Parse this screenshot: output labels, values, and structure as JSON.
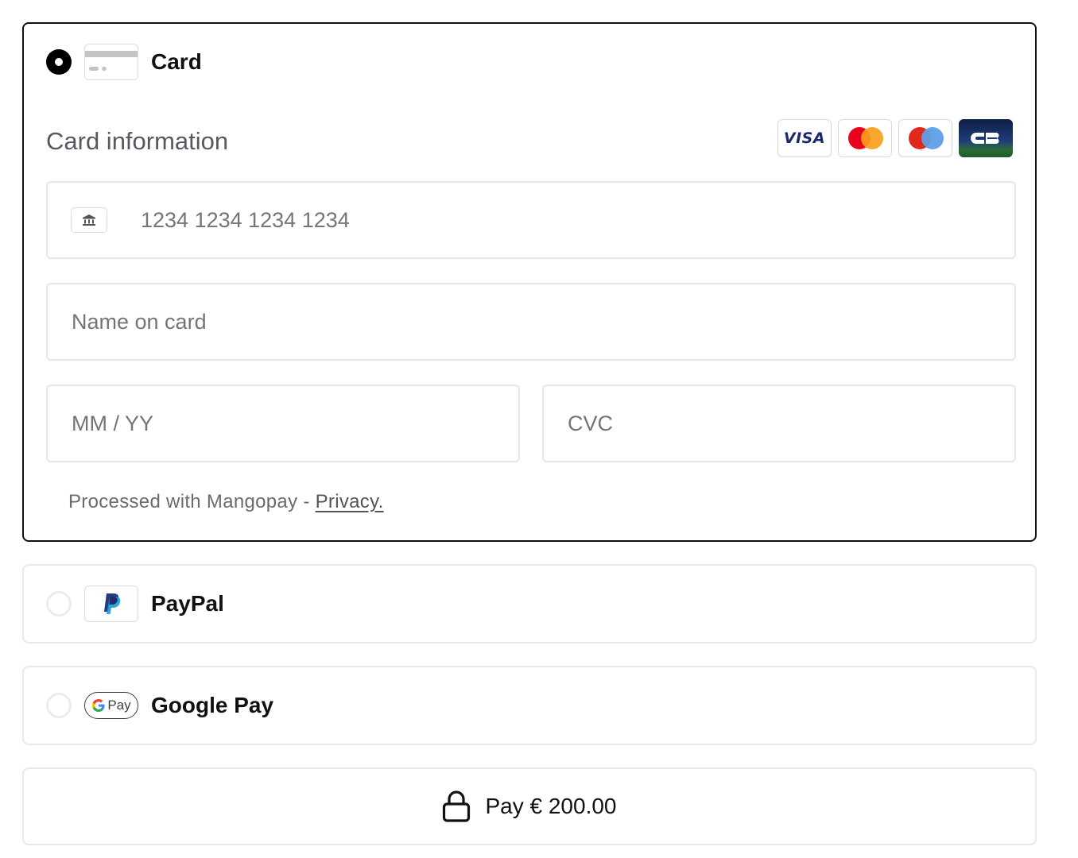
{
  "methods": {
    "card": {
      "label": "Card",
      "selected": true,
      "icon": "credit-card-icon",
      "card_information_title": "Card information",
      "brands": [
        {
          "name": "visa",
          "text": "VISA"
        },
        {
          "name": "mastercard"
        },
        {
          "name": "maestro"
        },
        {
          "name": "cb"
        }
      ],
      "fields": {
        "card_number": {
          "placeholder": "1234 1234 1234 1234",
          "icon": "bank-icon"
        },
        "name_on_card": {
          "placeholder": "Name on card"
        },
        "expiry": {
          "placeholder": "MM / YY"
        },
        "cvc": {
          "placeholder": "CVC"
        }
      },
      "processed_text": "Processed with Mangopay - ",
      "privacy_link": "Privacy."
    },
    "paypal": {
      "label": "PayPal",
      "selected": false,
      "icon": "paypal-icon"
    },
    "googlepay": {
      "label": "Google Pay",
      "selected": false,
      "icon": "google-pay-icon",
      "pill_pay_text": "Pay"
    }
  },
  "pay_button": {
    "label": "Pay € 200.00",
    "icon": "lock-icon"
  },
  "colors": {
    "selected_border": "#111111",
    "field_border": "#e6e6e6",
    "placeholder": "#757575",
    "mastercard_red": "#eb001b",
    "mastercard_orange": "#f79e1b",
    "maestro_blue": "#5da0e6",
    "visa_navy": "#1a2a6c",
    "paypal_dark": "#253b80",
    "paypal_light": "#179bd7"
  }
}
